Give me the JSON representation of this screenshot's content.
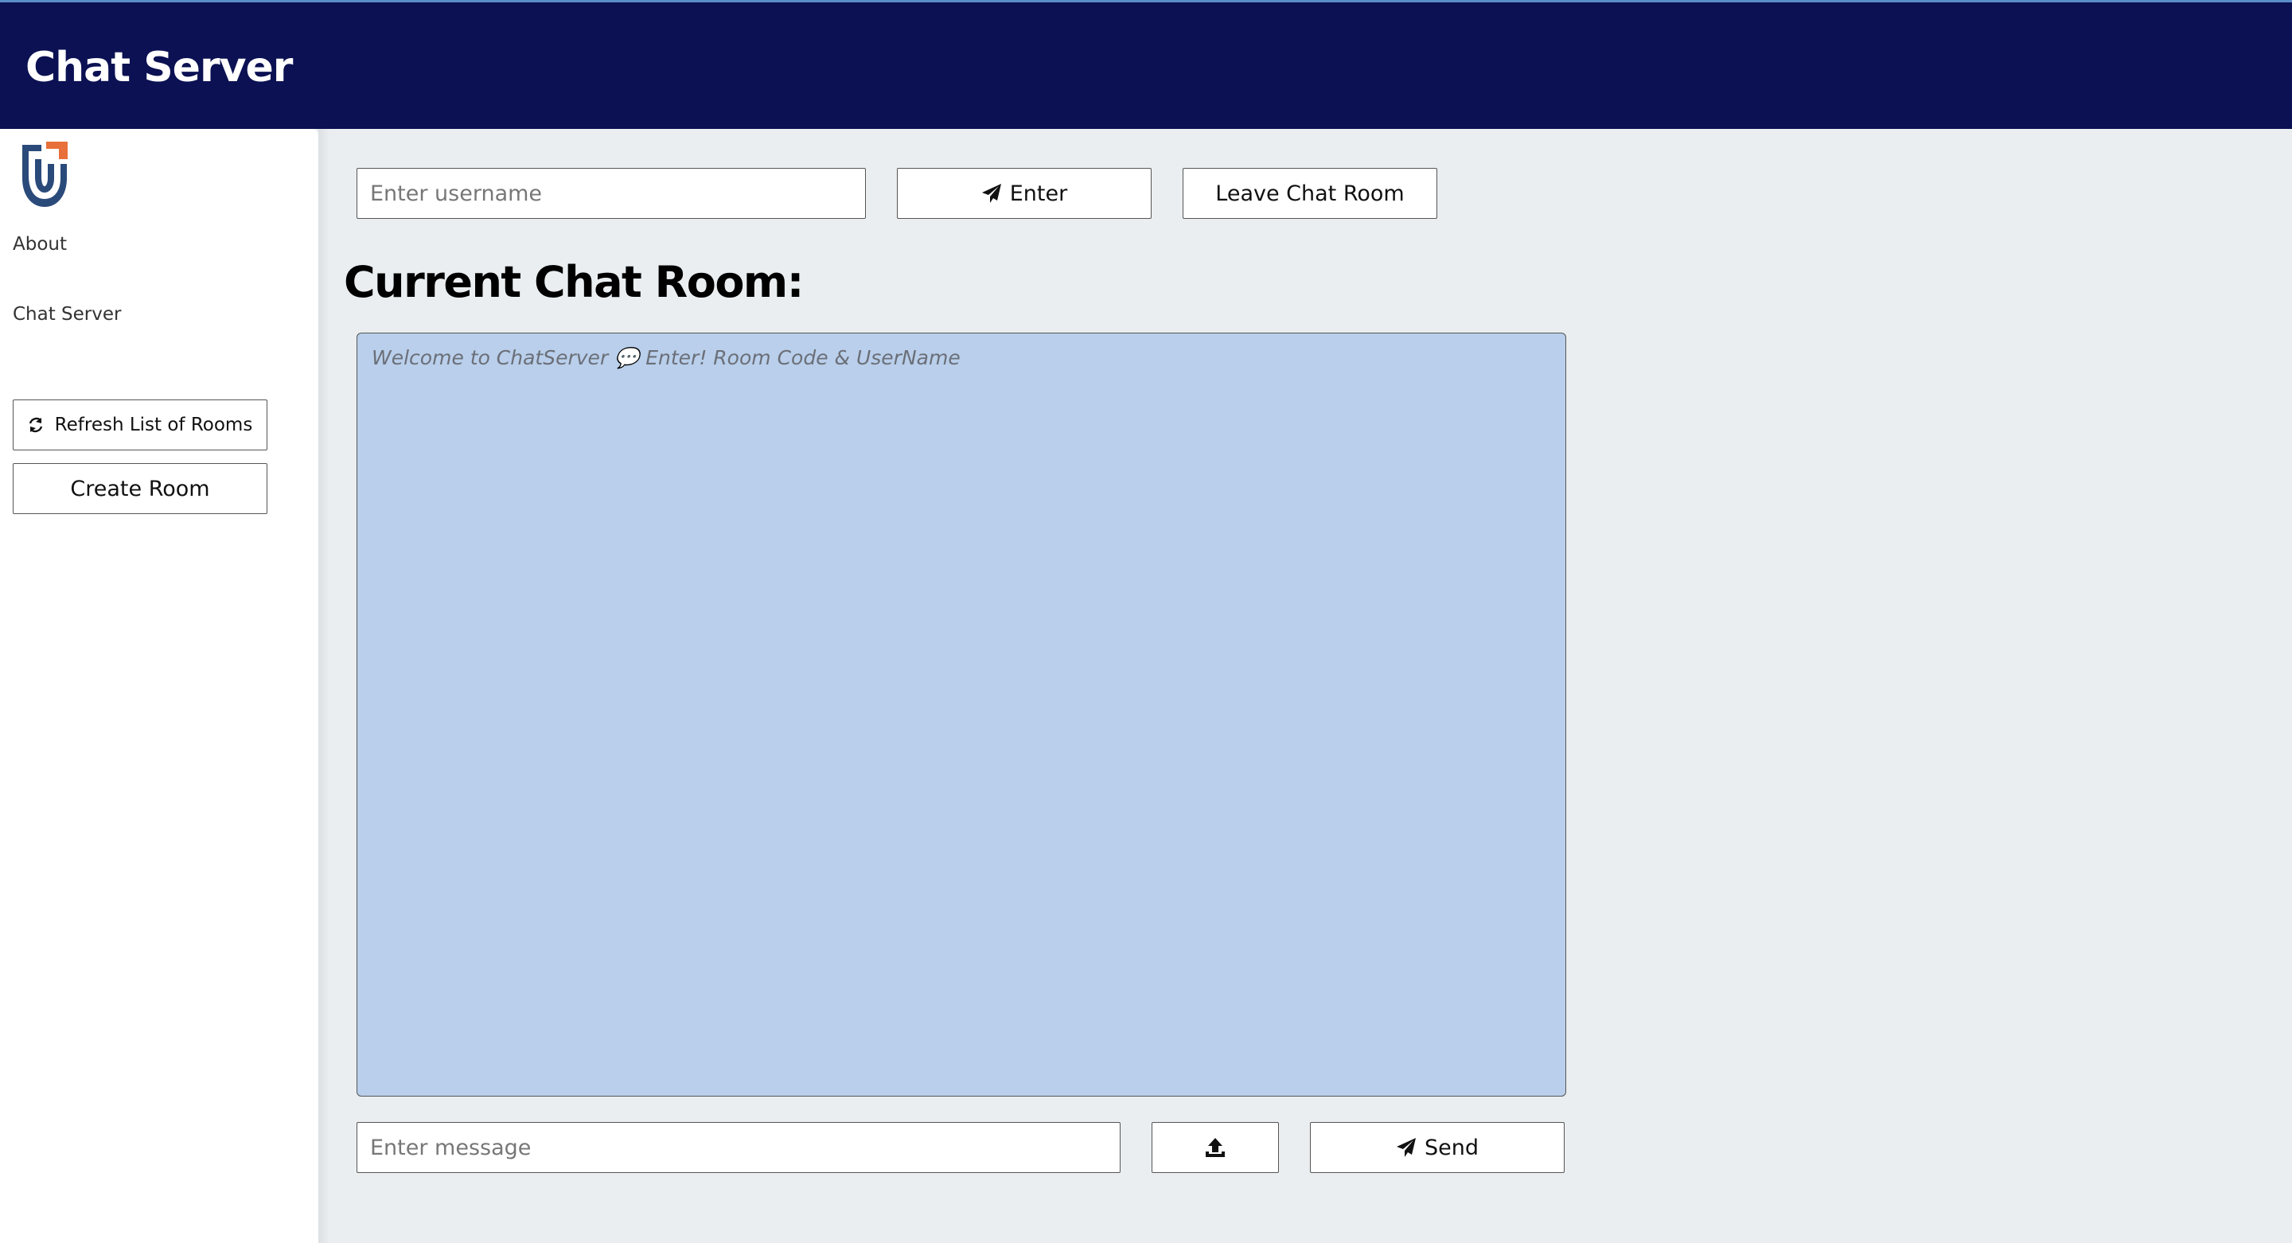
{
  "header": {
    "title": "Chat Server"
  },
  "sidebar": {
    "logo_icon": "brand-logo-icon",
    "nav": [
      {
        "label": "About"
      },
      {
        "label": "Chat Server"
      }
    ],
    "refresh_button": {
      "label": "Refresh List of Rooms",
      "icon": "refresh-icon"
    },
    "create_room_button": {
      "label": "Create Room"
    }
  },
  "room_controls": {
    "username_placeholder": "Enter username",
    "username_value": "",
    "enter_button": {
      "label": "Enter",
      "icon": "paper-plane-icon"
    },
    "leave_button": {
      "label": "Leave Chat Room"
    }
  },
  "chat": {
    "heading": "Current Chat Room:",
    "placeholder": "Welcome to ChatServer 💬 Enter! Room Code & UserName"
  },
  "composer": {
    "message_placeholder": "Enter message",
    "message_value": "",
    "upload_icon": "upload-icon",
    "send_button": {
      "label": "Send",
      "icon": "paper-plane-icon"
    }
  },
  "colors": {
    "header_bg": "#0b1152",
    "sidebar_bg": "#ffffff",
    "main_bg": "#eaeef0",
    "chat_bg": "#b9cfeb",
    "logo_blue": "#2a4a7a",
    "logo_orange": "#e8703a"
  }
}
